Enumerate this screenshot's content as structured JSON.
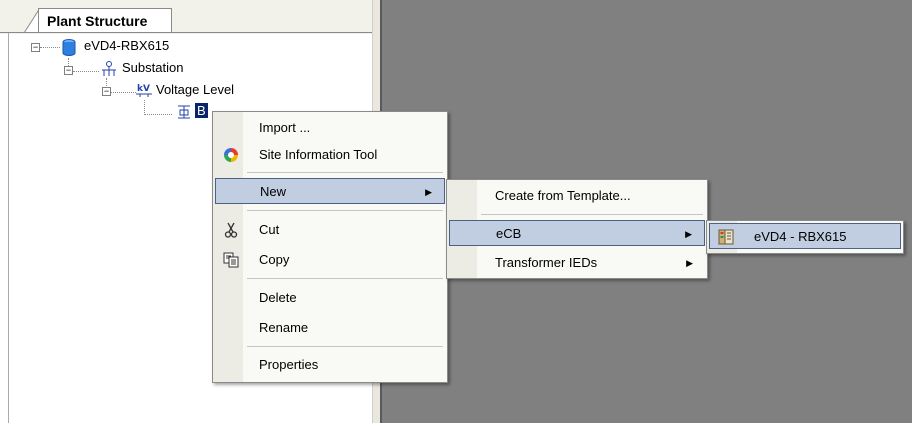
{
  "tab": {
    "label": "Plant Structure"
  },
  "tree": {
    "root": {
      "label": "eVD4-RBX615",
      "expander": "−"
    },
    "substation": {
      "label": "Substation",
      "expander": "−"
    },
    "voltage_level": {
      "label": "Voltage Level",
      "expander": "−"
    },
    "bay": {
      "label": "B"
    }
  },
  "context_menu": {
    "items": [
      {
        "label": "Import ..."
      },
      {
        "label": "Site Information Tool",
        "icon": "site-information-icon"
      },
      {
        "label": "New",
        "submenu": true
      },
      {
        "label": "Cut",
        "icon": "scissors-icon"
      },
      {
        "label": "Copy",
        "icon": "copy-icon"
      },
      {
        "label": "Delete"
      },
      {
        "label": "Rename"
      },
      {
        "label": "Properties"
      }
    ]
  },
  "new_submenu": {
    "items": [
      {
        "label": "Create from Template..."
      },
      {
        "label": "eCB",
        "submenu": true
      },
      {
        "label": "Transformer IEDs",
        "submenu": true
      }
    ]
  },
  "ecb_submenu": {
    "items": [
      {
        "label": "eVD4 - RBX615",
        "icon": "ied-device-icon"
      }
    ]
  },
  "glyphs": {
    "submenu_arrow": "▶"
  },
  "colors": {
    "highlight_fill": "#c1cde0",
    "highlight_border": "#4d6185",
    "menu_bg": "#f9f9f6",
    "workspace_bg": "#808080"
  }
}
